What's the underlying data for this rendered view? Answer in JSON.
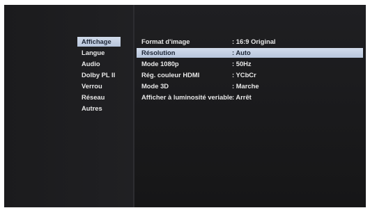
{
  "menu": {
    "items": [
      {
        "label": "Affichage",
        "active": true
      },
      {
        "label": "Langue"
      },
      {
        "label": "Audio"
      },
      {
        "label": "Dolby PL II"
      },
      {
        "label": "Verrou"
      },
      {
        "label": "Réseau"
      },
      {
        "label": "Autres"
      }
    ]
  },
  "settings": {
    "rows": [
      {
        "label": "Format d'image",
        "value": ": 16:9 Original"
      },
      {
        "label": "Résolution",
        "value": ": Auto",
        "active": true
      },
      {
        "label": "Mode 1080p",
        "value": ": 50Hz"
      },
      {
        "label": "Rég. couleur HDMI",
        "value": ": YCbCr"
      },
      {
        "label": "Mode 3D",
        "value": ": Marche"
      },
      {
        "label": "Afficher à luminosité veriable",
        "value": ": Arrêt"
      }
    ]
  }
}
